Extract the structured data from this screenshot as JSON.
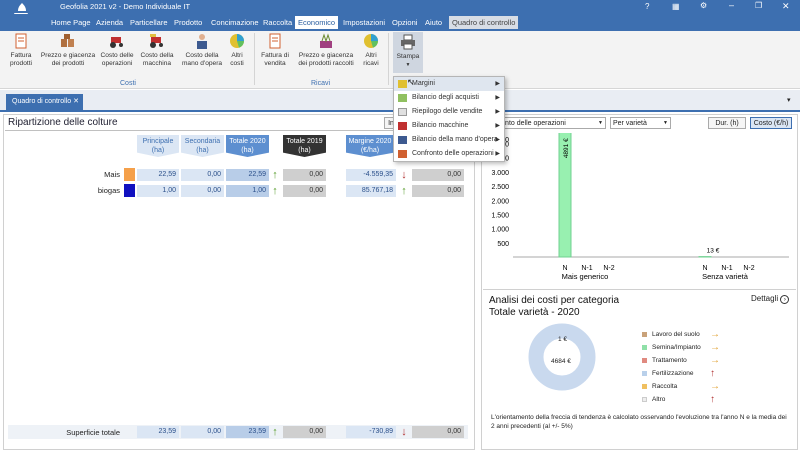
{
  "window": {
    "title": "Geofolia 2021 v2 - Demo Individuale IT"
  },
  "menu": {
    "items": [
      {
        "label": "Home Page"
      },
      {
        "label": "Azienda"
      },
      {
        "label": "Particellare"
      },
      {
        "label": "Prodotto"
      },
      {
        "label": "Concimazione"
      },
      {
        "label": "Raccolta"
      },
      {
        "label": "Economico"
      },
      {
        "label": "Impostazioni"
      },
      {
        "label": "Opzioni"
      },
      {
        "label": "Aiuto"
      },
      {
        "label": "Quadro di controllo"
      }
    ]
  },
  "ribbon": {
    "costi": [
      {
        "label": "Fattura prodotti"
      },
      {
        "label": "Prezzo e giacenza dei prodotti"
      },
      {
        "label": "Costo delle operazioni"
      },
      {
        "label": "Costo della macchina"
      },
      {
        "label": "Costo della mano d'opera"
      },
      {
        "label": "Altri costi"
      }
    ],
    "ricavi": [
      {
        "label": "Fattura di vendita"
      },
      {
        "label": "Prezzo e giacenza dei prodotti raccolti"
      },
      {
        "label": "Altri ricavi"
      }
    ],
    "group_costi": "Costi",
    "group_ricavi": "Ricavi",
    "stampa": "Stampa"
  },
  "dropdown": {
    "items": [
      {
        "label": "Margini",
        "sub": true
      },
      {
        "label": "Bilancio degli acquisti",
        "sub": true
      },
      {
        "label": "Riepilogo delle vendite",
        "sub": true
      },
      {
        "label": "Bilancio macchine",
        "sub": true
      },
      {
        "label": "Bilancio della mano d'opera",
        "sub": true
      },
      {
        "label": "Confronto delle operazioni",
        "sub": true
      }
    ]
  },
  "tab": {
    "label": "Quadro di controllo"
  },
  "left": {
    "title": "Ripartizione delle colture",
    "button_partial": "In",
    "headers": {
      "principale": "Principale (ha)",
      "secondaria": "Secondaria (ha)",
      "totale2020": "Totale 2020 (ha)",
      "totale2019": "Totale 2019 (ha)",
      "margine": "Margine 2020 (€/ha)"
    },
    "rows": [
      {
        "name": "Mais",
        "color": "#f5a04a",
        "principale": "22,59",
        "secondaria": "0,00",
        "tot2020": "22,59",
        "tot2019": "0,00",
        "margine": "-4.559,35",
        "last": "0,00"
      },
      {
        "name": "biogas",
        "color": "#1010c0",
        "principale": "1,00",
        "secondaria": "0,00",
        "tot2020": "1,00",
        "tot2019": "0,00",
        "margine": "85.767,18",
        "last": "0,00"
      }
    ],
    "footer": {
      "label": "Superficie totale",
      "principale": "23,59",
      "secondaria": "0,00",
      "tot2020": "23,59",
      "tot2019": "0,00",
      "margine": "-730,89",
      "last": "0,00"
    }
  },
  "right": {
    "select_ops": "nfronto delle operazioni",
    "select_var": "Per varietà",
    "btn_dur": "Dur. (h)",
    "btn_cost": "Costo (€/h)",
    "analysis_title": "Analisi dei costi per categoria",
    "analysis_sub": "Totale varietà - 2020",
    "details": "Dettagli",
    "note": "L'orientamento della freccia di tendenza è calcolato osservando l'evoluzione tra l'anno N e la media dei 2 anni precedenti (al +/- 5%)",
    "legend": [
      {
        "label": "Lavoro del suolo",
        "color": "#c9a27a",
        "trend": "right"
      },
      {
        "label": "Semina/Impianto",
        "color": "#8fe0a8",
        "trend": "right"
      },
      {
        "label": "Trattamento",
        "color": "#e08a80",
        "trend": "right"
      },
      {
        "label": "Fertilizzazione",
        "color": "#b9d0ea",
        "trend": "up"
      },
      {
        "label": "Raccolta",
        "color": "#f0c060",
        "trend": "right"
      },
      {
        "label": "Altro",
        "color": "#eeeeee",
        "trend": "up"
      }
    ],
    "donut": {
      "outer_label": "1 €",
      "inner_label": "4684 €"
    }
  },
  "chart_data": {
    "type": "bar",
    "y_ticks": [
      "4.000",
      "3.500",
      "3.000",
      "2.500",
      "2.000",
      "1.500",
      "1.000",
      "500"
    ],
    "y_partial_top": "00",
    "ylim": [
      0,
      4300
    ],
    "groups": [
      {
        "name": "Mais generico",
        "bars": [
          {
            "label": "N",
            "value": 4891,
            "text": "4891 €"
          },
          {
            "label": "N-1",
            "value": 0
          },
          {
            "label": "N-2",
            "value": 0
          }
        ]
      },
      {
        "name": "Senza varietà",
        "bars": [
          {
            "label": "N",
            "value": 13,
            "text": "13 €"
          },
          {
            "label": "N-1",
            "value": 0
          },
          {
            "label": "N-2",
            "value": 0
          }
        ]
      }
    ]
  }
}
